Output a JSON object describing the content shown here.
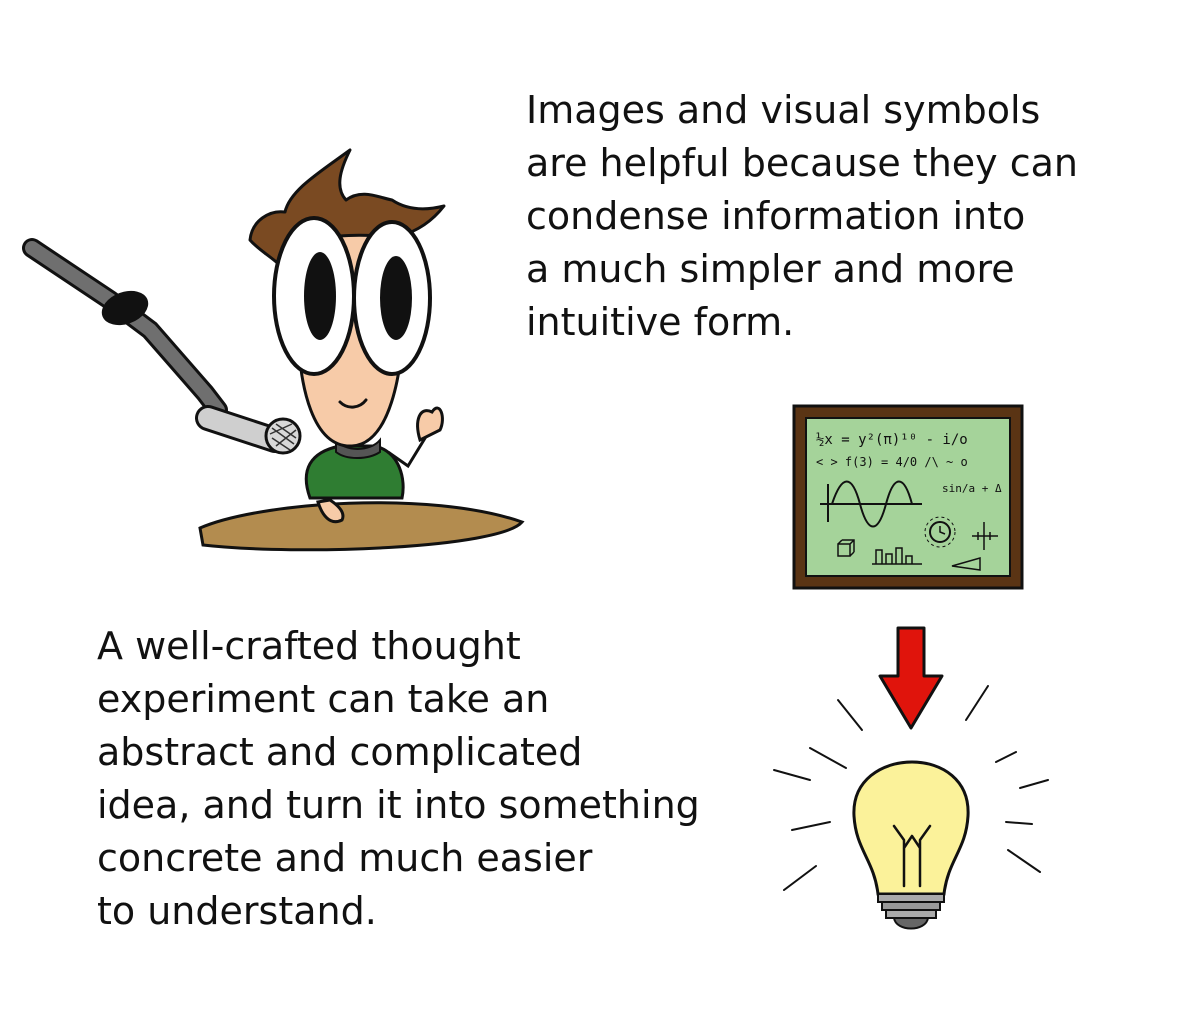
{
  "captions": {
    "visual_symbols": "Images and visual symbols\nare helpful because they can\ncondense information into\na much simpler and more\nintuitive form.",
    "thought_experiment": "A well-crafted thought\nexperiment can take an\nabstract and complicated\nidea, and turn it into something\nconcrete and much easier\nto understand."
  },
  "chalkboard": {
    "formula_line1": "½x = y²(π)¹⁰ - i/o",
    "formula_line2": "< > f(3) = 4/0 /\\ ~ o",
    "formula_sin": "sin/a + Δ"
  },
  "colors": {
    "hair": "#7a4a22",
    "skin": "#f7cba8",
    "shirt": "#2f7d32",
    "desk": "#b38c4f",
    "board_frame": "#5a3414",
    "board_surface": "#a5d39a",
    "arrow": "#e0140c",
    "bulb": "#fbf29a"
  },
  "icons": [
    "microphone-icon",
    "chalkboard-icon",
    "arrow-down-icon",
    "lightbulb-icon"
  ]
}
